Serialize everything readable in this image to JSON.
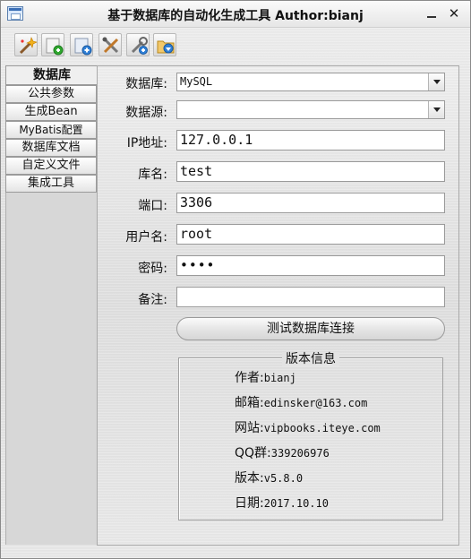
{
  "window": {
    "title": "基于数据库的自动化生成工具 Author:bianj",
    "minimize": "—",
    "close": "✕"
  },
  "toolbar": {
    "tools": [
      "wand-icon",
      "new-icon",
      "add-icon",
      "tools-icon",
      "config-icon",
      "download-folder-icon"
    ]
  },
  "nav": {
    "items": [
      {
        "label": "数据库",
        "active": true
      },
      {
        "label": "公共参数"
      },
      {
        "label": "生成Bean"
      },
      {
        "label": "MyBatis配置"
      },
      {
        "label": "数据库文档"
      },
      {
        "label": "自定义文件"
      },
      {
        "label": "集成工具"
      }
    ]
  },
  "form": {
    "database_label": "数据库:",
    "database_value": "MySQL",
    "datasource_label": "数据源:",
    "datasource_value": "",
    "ip_label": "IP地址:",
    "ip_value": "127.0.0.1",
    "dbname_label": "库名:",
    "dbname_value": "test",
    "port_label": "端口:",
    "port_value": "3306",
    "user_label": "用户名:",
    "user_value": "root",
    "password_label": "密码:",
    "password_value": "••••",
    "remark_label": "备注:",
    "remark_value": "",
    "test_button": "测试数据库连接"
  },
  "version": {
    "legend": "版本信息",
    "author_label": "作者:",
    "author_value": "bianj",
    "email_label": "邮箱:",
    "email_value": "edinsker@163.com",
    "site_label": "网站:",
    "site_value": "vipbooks.iteye.com",
    "qq_label": "QQ群:",
    "qq_value": "339206976",
    "ver_label": "版本:",
    "ver_value": "v5.8.0",
    "date_label": "日期:",
    "date_value": "2017.10.10"
  }
}
